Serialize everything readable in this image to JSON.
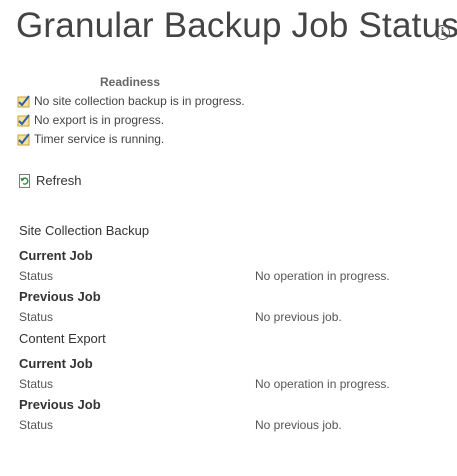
{
  "page": {
    "title": "Granular Backup Job Status",
    "info_icon": "info-icon"
  },
  "readiness": {
    "heading": "Readiness",
    "items": [
      {
        "text": "No site collection backup is in progress.",
        "icon": "check-icon"
      },
      {
        "text": "No export is in progress.",
        "icon": "check-icon"
      },
      {
        "text": "Timer service is running.",
        "icon": "check-icon"
      }
    ]
  },
  "refresh": {
    "label": "Refresh",
    "icon": "refresh-icon"
  },
  "sections": [
    {
      "title": "Site Collection Backup",
      "jobs": [
        {
          "heading": "Current Job",
          "status_label": "Status",
          "status_value": "No operation in progress."
        },
        {
          "heading": "Previous Job",
          "status_label": "Status",
          "status_value": "No previous job."
        }
      ]
    },
    {
      "title": "Content Export",
      "jobs": [
        {
          "heading": "Current Job",
          "status_label": "Status",
          "status_value": "No operation in progress."
        },
        {
          "heading": "Previous Job",
          "status_label": "Status",
          "status_value": "No previous job."
        }
      ]
    }
  ],
  "colors": {
    "text": "#444444",
    "check_gold": "#d9a520",
    "check_blue": "#2e5fa8"
  }
}
